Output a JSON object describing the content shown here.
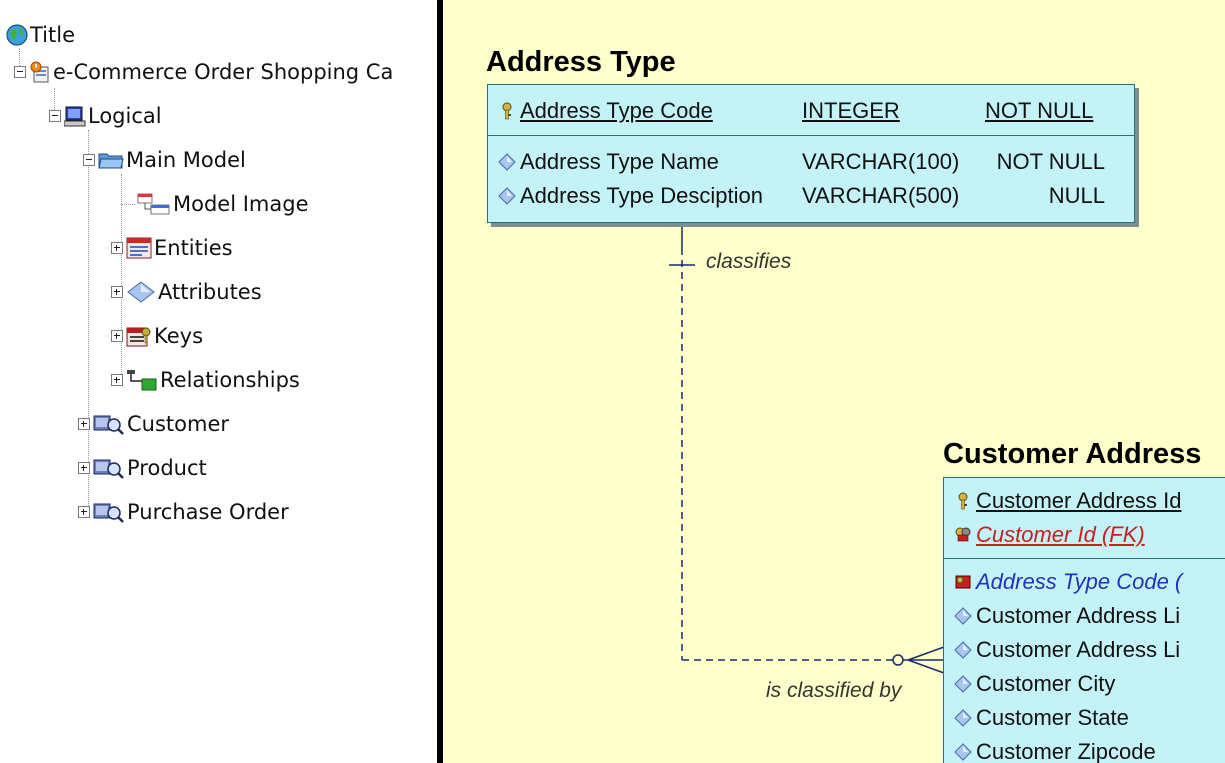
{
  "tree": {
    "root": "Title",
    "model": "e-Commerce Order Shopping Ca",
    "logical": "Logical",
    "main_model": "Main Model",
    "model_image": "Model Image",
    "entities": "Entities",
    "attributes": "Attributes",
    "keys": "Keys",
    "relationships": "Relationships",
    "customer": "Customer",
    "product": "Product",
    "purchase_order": "Purchase Order"
  },
  "diagram": {
    "address_type": {
      "title": "Address Type",
      "pk": [
        {
          "name": "Address Type Code",
          "type": "INTEGER",
          "null": "NOT NULL"
        }
      ],
      "attrs": [
        {
          "name": "Address Type Name",
          "type": "VARCHAR(100)",
          "null": "NOT NULL"
        },
        {
          "name": "Address Type Desciption",
          "type": "VARCHAR(500)",
          "null": "NULL"
        }
      ]
    },
    "customer_address": {
      "title": "Customer Address",
      "pk": [
        "Customer Address Id",
        "Customer Id (FK)"
      ],
      "attrs": [
        "Address Type Code (",
        "Customer Address Li",
        "Customer Address Li",
        "Customer City",
        "Customer State",
        "Customer Zipcode"
      ]
    },
    "relationship": {
      "parent_label": "classifies",
      "child_label": "is classified by"
    }
  },
  "colors": {
    "canvas": "#ffffcc",
    "entity_fill": "#c4f3f7",
    "entity_border": "#2a6f7a",
    "fk_text": "#c8201e",
    "alt_key_text": "#2233bb",
    "relationship_line": "#1c2a6e"
  }
}
